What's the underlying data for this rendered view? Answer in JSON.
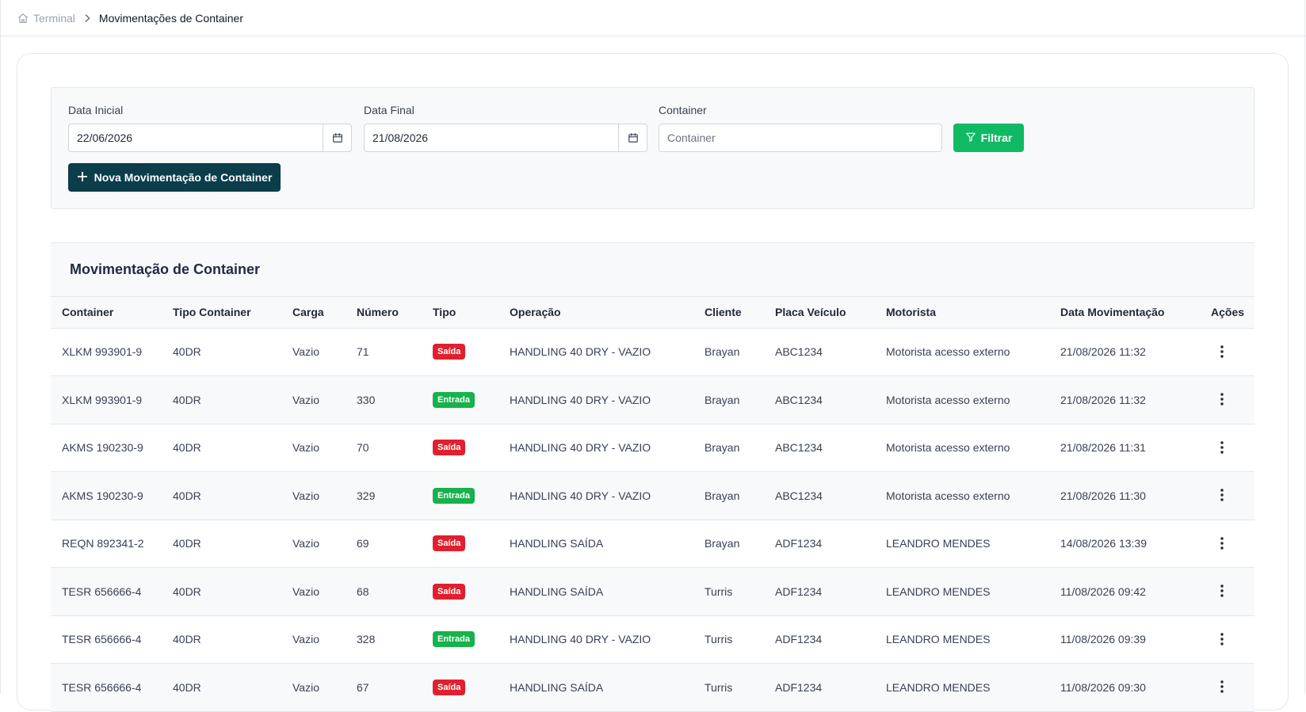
{
  "breadcrumb": {
    "home_icon": "home-icon",
    "root": "Terminal",
    "separator_icon": "chevron-right-icon",
    "current": "Movimentações de Container"
  },
  "filters": {
    "start_date": {
      "label": "Data Inicial",
      "value": "22/06/2026",
      "icon": "calendar-icon"
    },
    "end_date": {
      "label": "Data Final",
      "value": "21/08/2026",
      "icon": "calendar-icon"
    },
    "container": {
      "label": "Container",
      "value": "",
      "placeholder": "Container"
    },
    "filter_button": {
      "label": "Filtrar",
      "icon": "filter-icon",
      "color": "#10b964"
    },
    "new_button": {
      "label": "Nova Movimentação de Container",
      "icon": "plus-icon",
      "color": "#0b3d4a"
    }
  },
  "table": {
    "title": "Movimentação de Container",
    "columns": [
      "Container",
      "Tipo Container",
      "Carga",
      "Número",
      "Tipo",
      "Operação",
      "Cliente",
      "Placa Veículo",
      "Motorista",
      "Data Movimentação",
      "Ações"
    ],
    "badge_colors": {
      "Saída": "#e0202e",
      "Entrada": "#16b24b"
    },
    "rows": [
      {
        "container": "XLKM 993901-9",
        "tipo_container": "40DR",
        "carga": "Vazio",
        "numero": "71",
        "tipo": "Saída",
        "operacao": "HANDLING 40 DRY - VAZIO",
        "cliente": "Brayan",
        "placa": "ABC1234",
        "motorista": "Motorista acesso externo",
        "data": "21/08/2026 11:32"
      },
      {
        "container": "XLKM 993901-9",
        "tipo_container": "40DR",
        "carga": "Vazio",
        "numero": "330",
        "tipo": "Entrada",
        "operacao": "HANDLING 40 DRY - VAZIO",
        "cliente": "Brayan",
        "placa": "ABC1234",
        "motorista": "Motorista acesso externo",
        "data": "21/08/2026 11:32"
      },
      {
        "container": "AKMS 190230-9",
        "tipo_container": "40DR",
        "carga": "Vazio",
        "numero": "70",
        "tipo": "Saída",
        "operacao": "HANDLING 40 DRY - VAZIO",
        "cliente": "Brayan",
        "placa": "ABC1234",
        "motorista": "Motorista acesso externo",
        "data": "21/08/2026 11:31"
      },
      {
        "container": "AKMS 190230-9",
        "tipo_container": "40DR",
        "carga": "Vazio",
        "numero": "329",
        "tipo": "Entrada",
        "operacao": "HANDLING 40 DRY - VAZIO",
        "cliente": "Brayan",
        "placa": "ABC1234",
        "motorista": "Motorista acesso externo",
        "data": "21/08/2026 11:30"
      },
      {
        "container": "REQN 892341-2",
        "tipo_container": "40DR",
        "carga": "Vazio",
        "numero": "69",
        "tipo": "Saída",
        "operacao": "HANDLING SAÍDA",
        "cliente": "Brayan",
        "placa": "ADF1234",
        "motorista": "LEANDRO MENDES",
        "data": "14/08/2026 13:39"
      },
      {
        "container": "TESR 656666-4",
        "tipo_container": "40DR",
        "carga": "Vazio",
        "numero": "68",
        "tipo": "Saída",
        "operacao": "HANDLING SAÍDA",
        "cliente": "Turris",
        "placa": "ADF1234",
        "motorista": "LEANDRO MENDES",
        "data": "11/08/2026 09:42"
      },
      {
        "container": "TESR 656666-4",
        "tipo_container": "40DR",
        "carga": "Vazio",
        "numero": "328",
        "tipo": "Entrada",
        "operacao": "HANDLING 40 DRY - VAZIO",
        "cliente": "Turris",
        "placa": "ADF1234",
        "motorista": "LEANDRO MENDES",
        "data": "11/08/2026 09:39"
      },
      {
        "container": "TESR 656666-4",
        "tipo_container": "40DR",
        "carga": "Vazio",
        "numero": "67",
        "tipo": "Saída",
        "operacao": "HANDLING SAÍDA",
        "cliente": "Turris",
        "placa": "ADF1234",
        "motorista": "LEANDRO MENDES",
        "data": "11/08/2026 09:30"
      }
    ],
    "actions_icon": "more-vertical-icon"
  }
}
